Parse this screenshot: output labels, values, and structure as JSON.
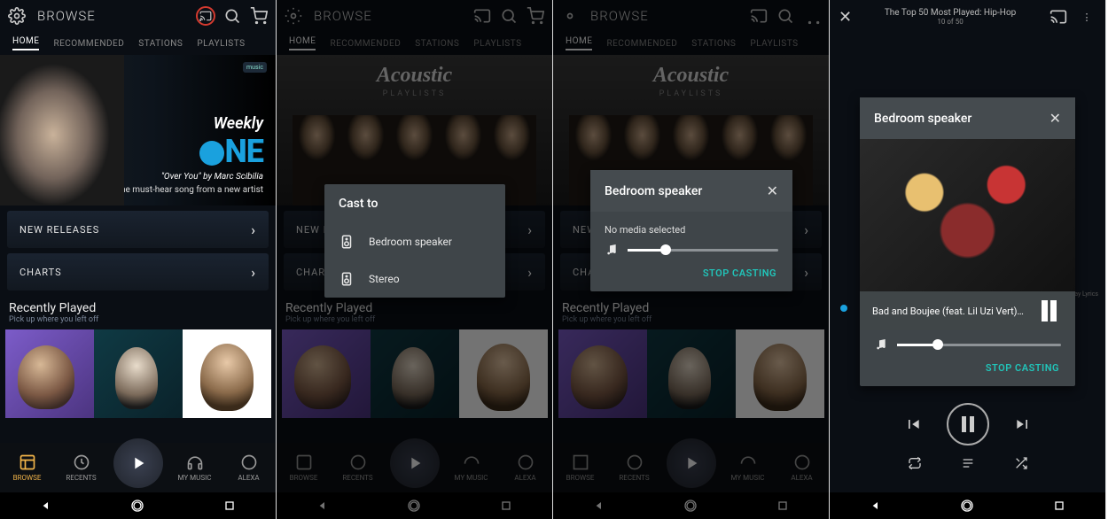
{
  "app": {
    "title": "BROWSE"
  },
  "tabs": {
    "home": "HOME",
    "recommended": "RECOMMENDED",
    "stations": "STATIONS",
    "playlists": "PLAYLISTS"
  },
  "hero": {
    "brand": "Weekly",
    "logo_suffix": "NE",
    "subtitle1": "\"Over You\" by Marc Scibilia",
    "subtitle2": "One must-hear song from a new artist",
    "badge": "music"
  },
  "hero_acoustic": {
    "title": "Acoustic",
    "subtitle": "PLAYLISTS"
  },
  "rows": {
    "new_releases": "NEW RELEASES",
    "charts": "CHARTS"
  },
  "recent": {
    "title": "Recently Played",
    "subtitle": "Pick up where you left off"
  },
  "nav": {
    "browse": "BROWSE",
    "recents": "RECENTS",
    "mymusic": "MY MUSIC",
    "alexa": "ALEXA"
  },
  "cast_to": {
    "title": "Cast to",
    "dev1": "Bedroom speaker",
    "dev2": "Stereo"
  },
  "cast_dialog": {
    "title": "Bedroom speaker",
    "no_media": "No media selected",
    "stop": "STOP CASTING",
    "vol_pct": 25
  },
  "player": {
    "queue_title": "The Top 50 Most Played: Hip-Hop",
    "queue_pos": "10 of 50",
    "track": "Bad and Boujee (feat. Lil Uzi Vert)…",
    "vol_pct": 25
  },
  "bg": {
    "xray": "X-Ray Lyrics"
  }
}
